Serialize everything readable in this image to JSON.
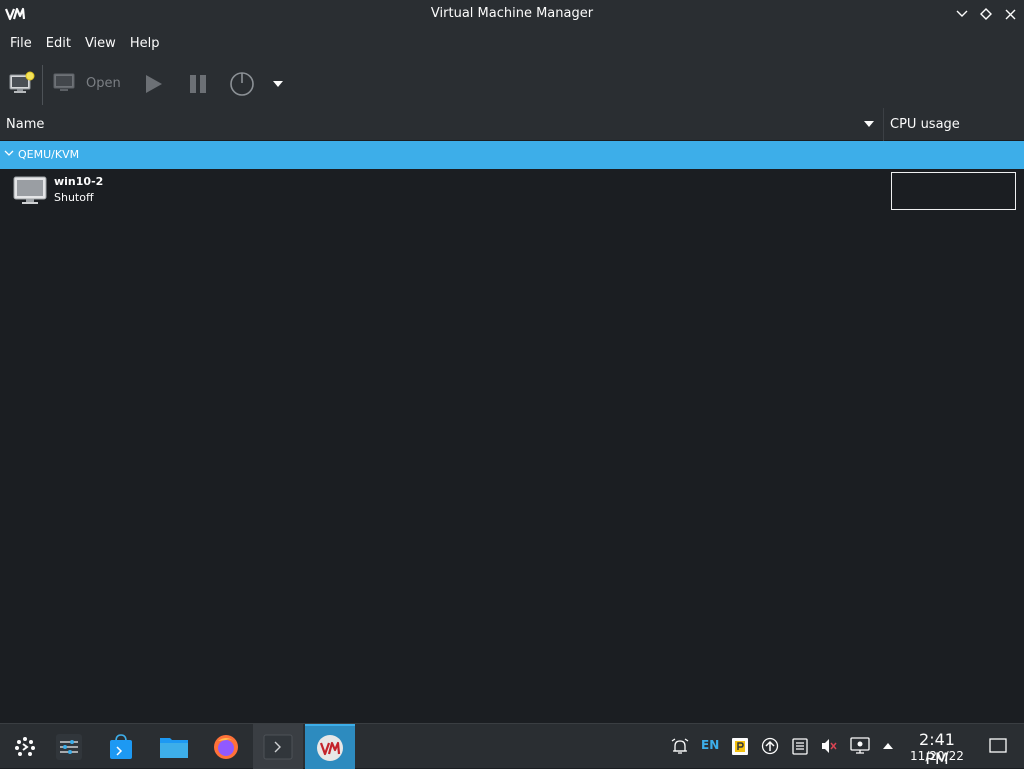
{
  "window": {
    "title": "Virtual Machine Manager",
    "app_icon_text": "VM"
  },
  "menu": {
    "items": [
      "File",
      "Edit",
      "View",
      "Help"
    ]
  },
  "toolbar": {
    "open_label": "Open"
  },
  "columns": {
    "name": "Name",
    "cpu": "CPU usage"
  },
  "connection": {
    "label": "QEMU/KVM"
  },
  "vms": [
    {
      "name": "win10-2",
      "status": "Shutoff"
    }
  ],
  "tray": {
    "keyboard_layout": "EN"
  },
  "clock": {
    "time": "2:41 PM",
    "date": "11/20/22"
  },
  "colors": {
    "accent": "#3daee9",
    "window_bg": "#1b1e22",
    "chrome_bg": "#2a2e32"
  }
}
